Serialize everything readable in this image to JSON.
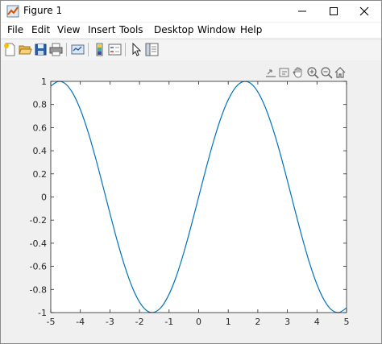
{
  "window": {
    "title": "Figure 1"
  },
  "menu": {
    "items": [
      "File",
      "Edit",
      "View",
      "Insert",
      "Tools",
      "Desktop",
      "Window",
      "Help"
    ]
  },
  "toolbar": {
    "icons": [
      "new-figure-icon",
      "open-file-icon",
      "save-icon",
      "print-icon",
      "link-plot-icon",
      "colorbar-icon",
      "legend-icon",
      "edit-plot-icon",
      "property-inspector-icon"
    ]
  },
  "axes_toolbar": {
    "icons": [
      "export-icon",
      "brush-icon",
      "pan-icon",
      "zoom-in-icon",
      "zoom-out-icon",
      "home-icon"
    ]
  },
  "colors": {
    "line": "#0072bd",
    "axes_background": "#ffffff",
    "figure_background": "#f0f0f0"
  },
  "chart_data": {
    "type": "line",
    "title": "",
    "xlabel": "",
    "ylabel": "",
    "xlim": [
      -5,
      5
    ],
    "ylim": [
      -1,
      1
    ],
    "grid": false,
    "x_ticks": [
      -5,
      -4,
      -3,
      -2,
      -1,
      0,
      1,
      2,
      3,
      4,
      5
    ],
    "y_ticks": [
      1,
      0.8,
      0.6,
      0.4,
      0.2,
      0,
      -0.2,
      -0.4,
      -0.6,
      -0.8,
      -1
    ],
    "x_tick_labels": [
      "-5",
      "-4",
      "-3",
      "-2",
      "-1",
      "0",
      "1",
      "2",
      "3",
      "4",
      "5"
    ],
    "y_tick_labels": [
      "1",
      "0.8",
      "0.6",
      "0.4",
      "0.2",
      "0",
      "-0.2",
      "-0.4",
      "-0.6",
      "-0.8",
      "-1"
    ],
    "series": [
      {
        "x": [
          -5.0,
          -4.75,
          -4.5,
          -4.25,
          -4.0,
          -3.75,
          -3.5,
          -3.25,
          -3.0,
          -2.75,
          -2.5,
          -2.25,
          -2.0,
          -1.75,
          -1.5,
          -1.25,
          -1.0,
          -0.75,
          -0.5,
          -0.25,
          0.0,
          0.25,
          0.5,
          0.75,
          1.0,
          1.25,
          1.5,
          1.75,
          2.0,
          2.25,
          2.5,
          2.75,
          3.0,
          3.25,
          3.5,
          3.75,
          4.0,
          4.25,
          4.5,
          4.75,
          5.0
        ],
        "y": [
          0.959,
          0.999,
          0.978,
          0.895,
          0.757,
          0.572,
          0.351,
          0.108,
          -0.141,
          -0.382,
          -0.598,
          -0.778,
          -0.909,
          -0.984,
          -0.997,
          -0.949,
          -0.841,
          -0.682,
          -0.479,
          -0.247,
          0.0,
          0.247,
          0.479,
          0.682,
          0.841,
          0.949,
          0.997,
          0.984,
          0.909,
          0.778,
          0.598,
          0.382,
          0.141,
          -0.108,
          -0.351,
          -0.572,
          -0.757,
          -0.895,
          -0.978,
          -0.999,
          -0.959
        ]
      }
    ]
  }
}
